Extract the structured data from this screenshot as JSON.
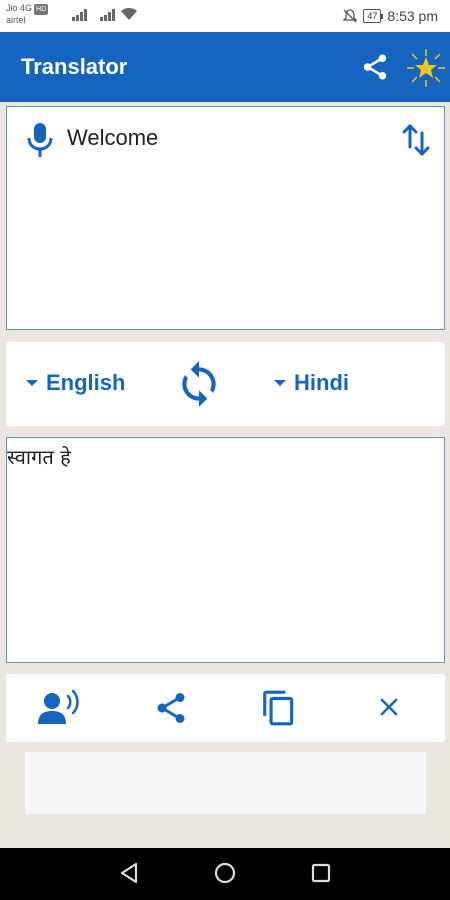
{
  "status_bar": {
    "carrier_1": "Jio 4G",
    "volte_badge": "HD",
    "carrier_2": "airtel",
    "battery": "47",
    "time": "8:53 pm"
  },
  "app_bar": {
    "title": "Translator",
    "share_icon": "share-icon",
    "rate_icon": "star-icon"
  },
  "input": {
    "text": "Welcome",
    "mic_icon": "mic-icon",
    "swap_icon": "swap-vertical-icon"
  },
  "languages": {
    "source": "English",
    "target": "Hindi",
    "swap_icon": "sync-icon"
  },
  "output": {
    "text": "स्वागत हे"
  },
  "actions": {
    "speak_icon": "speak-icon",
    "share_icon": "share-icon",
    "copy_icon": "copy-icon",
    "clear_icon": "close-icon"
  },
  "colors": {
    "primary": "#1565c0",
    "accent_star": "#f5c518",
    "background": "#eae6e0"
  }
}
